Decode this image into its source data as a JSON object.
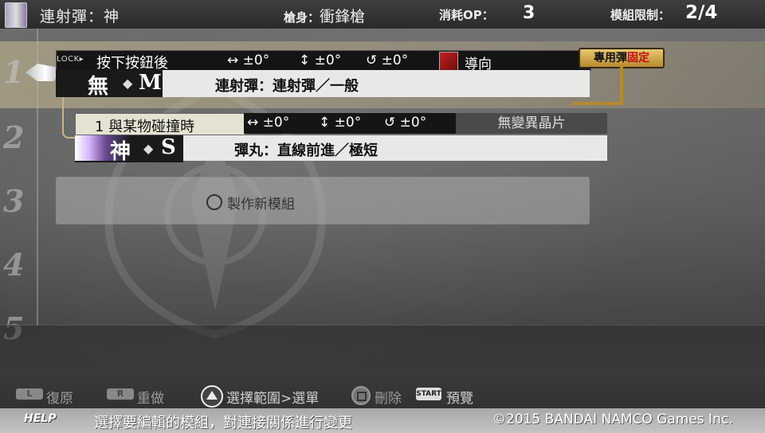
{
  "header": {
    "title": "連射彈：神",
    "gun_label": "槍身：",
    "gun_value": "衝鋒槍",
    "op_label": "消耗OP：",
    "op_value": "3",
    "limit_label": "模組限制：",
    "limit_value": "2/4"
  },
  "rows": [
    "1",
    "2",
    "3",
    "4",
    "5"
  ],
  "module1": {
    "lock": "LOCK▸",
    "trigger": "按下按鈕後",
    "angle_h": "↔ ±0°",
    "angle_v": "↕ ±0°",
    "angle_r": "↺ ±0°",
    "guide": "導向",
    "symbol": "無",
    "size": "M",
    "text": "連射彈：連射彈／一般",
    "badge_normal": "專用彈",
    "badge_red": "固定"
  },
  "module2": {
    "condition": "1 與某物碰撞時",
    "angle_h": "↔ ±0°",
    "angle_v": "↕ ±0°",
    "angle_r": "↺ ±0°",
    "variation": "無變異晶片",
    "symbol": "神",
    "size": "S",
    "text": "彈丸：直線前進／極短"
  },
  "new_module": {
    "label": "製作新模組"
  },
  "controls": {
    "l_btn": "L",
    "undo": "復原",
    "r_btn": "R",
    "redo": "重做",
    "select_range": "選擇範圍>選單",
    "delete": "刪除",
    "start_btn": "START",
    "preview": "預覽"
  },
  "help": {
    "label": "HELP",
    "text": "選擇要編輯的模組，對連接關係進行變更",
    "copyright": "©2015 BANDAI NAMCO Games Inc."
  },
  "colors": {
    "badge_gold": "#b58a2e",
    "badge_red": "#c21010",
    "guide_icon": "#c52020"
  }
}
